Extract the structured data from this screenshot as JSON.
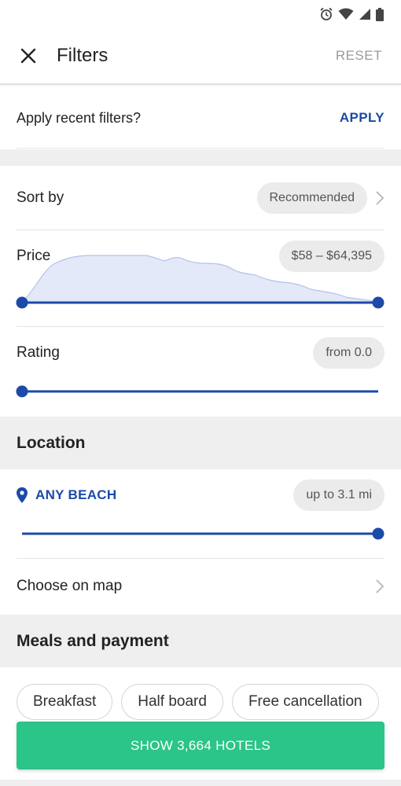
{
  "header": {
    "title": "Filters",
    "reset_label": "RESET"
  },
  "recent": {
    "text": "Apply recent filters?",
    "apply_label": "APPLY"
  },
  "sort": {
    "label": "Sort by",
    "value": "Recommended"
  },
  "price": {
    "label": "Price",
    "value": "$58 – $64,395",
    "range_fraction": [
      0.0,
      1.0
    ]
  },
  "rating": {
    "label": "Rating",
    "value": "from 0.0",
    "level_fraction": 0.0
  },
  "location": {
    "section_title": "Location",
    "place": "ANY BEACH",
    "distance": "up to 3.1 mi",
    "distance_level_fraction": 1.0,
    "map_label": "Choose on map"
  },
  "meals": {
    "section_title": "Meals and payment",
    "chips": [
      "Breakfast",
      "Half board",
      "Free cancellation"
    ]
  },
  "cta_label": "SHOW 3,664 HOTELS",
  "colors": {
    "accent_blue": "#1b4aa8",
    "cta_green": "#2bc489",
    "histogram_fill": "#e3e9f8",
    "section_bg": "#efeff0"
  },
  "icons": {
    "close": "close-icon",
    "chevron": "chevron-right-icon",
    "location": "location-pin-icon",
    "alarm": "alarm-icon",
    "wifi": "wifi-icon",
    "signal": "signal-icon",
    "battery": "battery-icon"
  }
}
